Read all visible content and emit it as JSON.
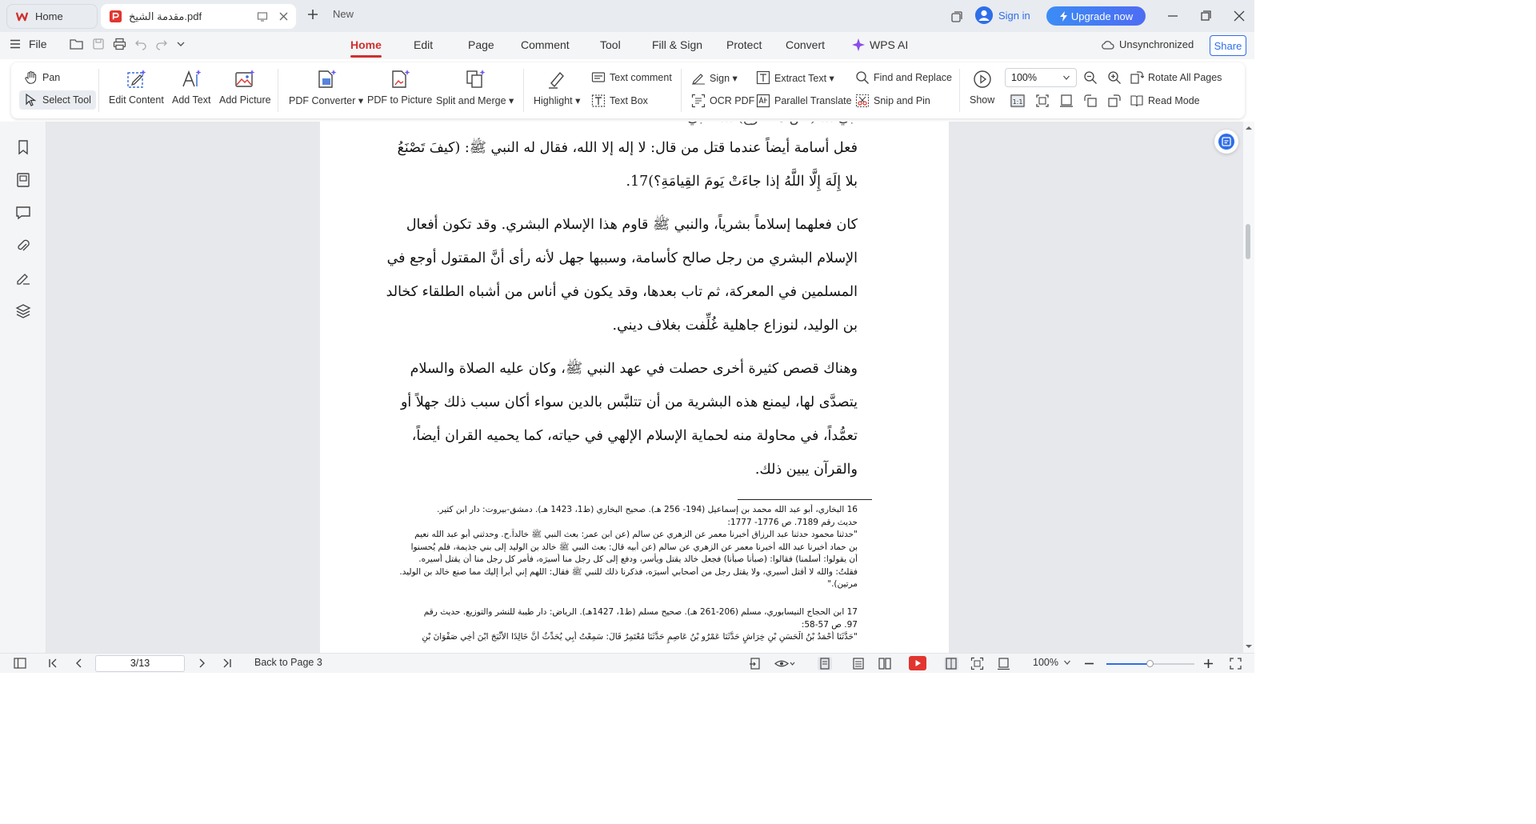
{
  "titlebar": {
    "home_tab": "Home",
    "doc_tab": "مقدمة الشيخ.pdf",
    "new_tab": "New",
    "sign_in": "Sign in",
    "upgrade": "Upgrade now"
  },
  "menubar": {
    "file": "File",
    "tabs": [
      "Home",
      "Edit",
      "Page",
      "Comment",
      "Tool",
      "Fill & Sign",
      "Protect",
      "Convert",
      "WPS AI"
    ],
    "active_tab": "Home",
    "sync_status": "Unsynchronized",
    "share": "Share"
  },
  "ribbon": {
    "pan": "Pan",
    "select_tool": "Select Tool",
    "edit_content": "Edit Content",
    "add_text": "Add Text",
    "add_picture": "Add Picture",
    "pdf_converter": "PDF Converter",
    "pdf_to_picture": "PDF to Picture",
    "split_merge": "Split and Merge",
    "highlight": "Highlight",
    "text_comment": "Text comment",
    "text_box": "Text Box",
    "sign": "Sign",
    "ocr_pdf": "OCR PDF",
    "extract_text": "Extract Text",
    "parallel_translate": "Parallel Translate",
    "find_replace": "Find and Replace",
    "snip_pin": "Snip and Pin",
    "show": "Show",
    "zoom": "100%",
    "rotate_all": "Rotate All Pages",
    "read_mode": "Read Mode"
  },
  "document": {
    "top_partial": "أبي ... (نص مقطوع) ... النبي",
    "para1": [
      "فعل أسامة أيضاً عندما قتل من قال: لا إله إلا الله، فقال له النبي ﷺ: (كيفَ تَصْنَعُ",
      "بلا إِلَهَ إِلَّا اللَّهُ إذا جاءَتْ يَومَ القِيامَةِ؟)17."
    ],
    "para2": [
      "كان فعلهما إسلاماً بشرياً، والنبي ﷺ قاوم هذا الإسلام البشري. وقد تكون أفعال",
      "الإسلام البشري من رجل صالح كأسامة، وسببها جهل لأنه رأى أنَّ المقتول أوجع في",
      "المسلمين في المعركة، ثم تاب بعدها، وقد يكون في أناس من أشباه الطلقاء كخالد",
      "بن الوليد، لنوزاع جاهلية غُلِّفت بغلاف ديني."
    ],
    "para3": [
      "وهناك قصص كثيرة أخرى حصلت في عهد النبي ﷺ، وكان عليه الصلاة والسلام",
      "يتصدَّى لها، ليمنع هذه البشرية من أن تتلبَّس بالدين سواء أكان سبب ذلك جهلاً أو",
      "تعمُّداً، في محاولة منه لحماية الإسلام الإلهي في حياته، كما يحميه القران أيضاً،",
      "والقرآن يبين ذلك."
    ],
    "footnotes": [
      "16 البخاري، أبو عبد الله محمد بن إسماعيل (194- 256 هـ). صحيح البخاري (ط1، 1423 هـ). دمشق-بيروت: دار ابن كثير.",
      "حديث رقم 7189. ص 1776- 1777:",
      "\"حدثنا محمود حدثنا عبد الرزاق أخبرنا معمر عن الزهري عن سالم (عن ابن عمر: بعث النبي ﷺ خالداً.ح. وحدثني أبو عبد الله نعيم",
      "بن حماد أخبرنا عبد الله أخبرنا معمر عن الزهري عن سالم (عن أبيه قال: بعث النبي ﷺ خالد بن الوليد إلى بني جذيمة، فلم يُحسنوا",
      "أن يقولوا: أسلمنا) فقالوا: (صبأنا صبأنا) فجعل خالد يقتل ويأسر، ودفع إلى كل رجل منا أسيرَه، فأمر كل رجل منا أن يقتل أسيره.",
      "فقلتُ: والله لا أقتل أسيري، ولا يقتل رجل من أصحابي أسيرَه، فذكرنا ذلك للنبي ﷺ فقال: اللهم إني أبرأ إليك مما صنع خالد بن الوليد.",
      "مرتين).\"",
      "17 ابن الحجاج النيسابوري، مسلم (206-261 هـ). صحيح مسلم (ط1، 1427هـ). الرياض: دار طيبة للنشر والتوزيع. حديث رقم",
      "97. ص 57-58:",
      "\"حَدَّثَنَا أَحْمَدُ بْنُ الْحَسَنِ بْنِ خِرَاشٍ حَدَّثَنَا عَمْرُو بْنُ عَاصِمٍ حَدَّثَنَا مُعْتَمِرٌ قَالَ: سَمِعْتُ أَبِي يُحَدِّثُ أَنَّ خَالِدًا الأَثْبَجَ ابْنَ أَخِي صَفْوَانَ بْنِ"
    ]
  },
  "statusbar": {
    "page": "3/13",
    "back": "Back to Page 3",
    "zoom": "100%"
  },
  "colors": {
    "accent": "#d0302e",
    "brand_blue": "#2e6ee8",
    "page_bg": "#e6e8eb"
  }
}
